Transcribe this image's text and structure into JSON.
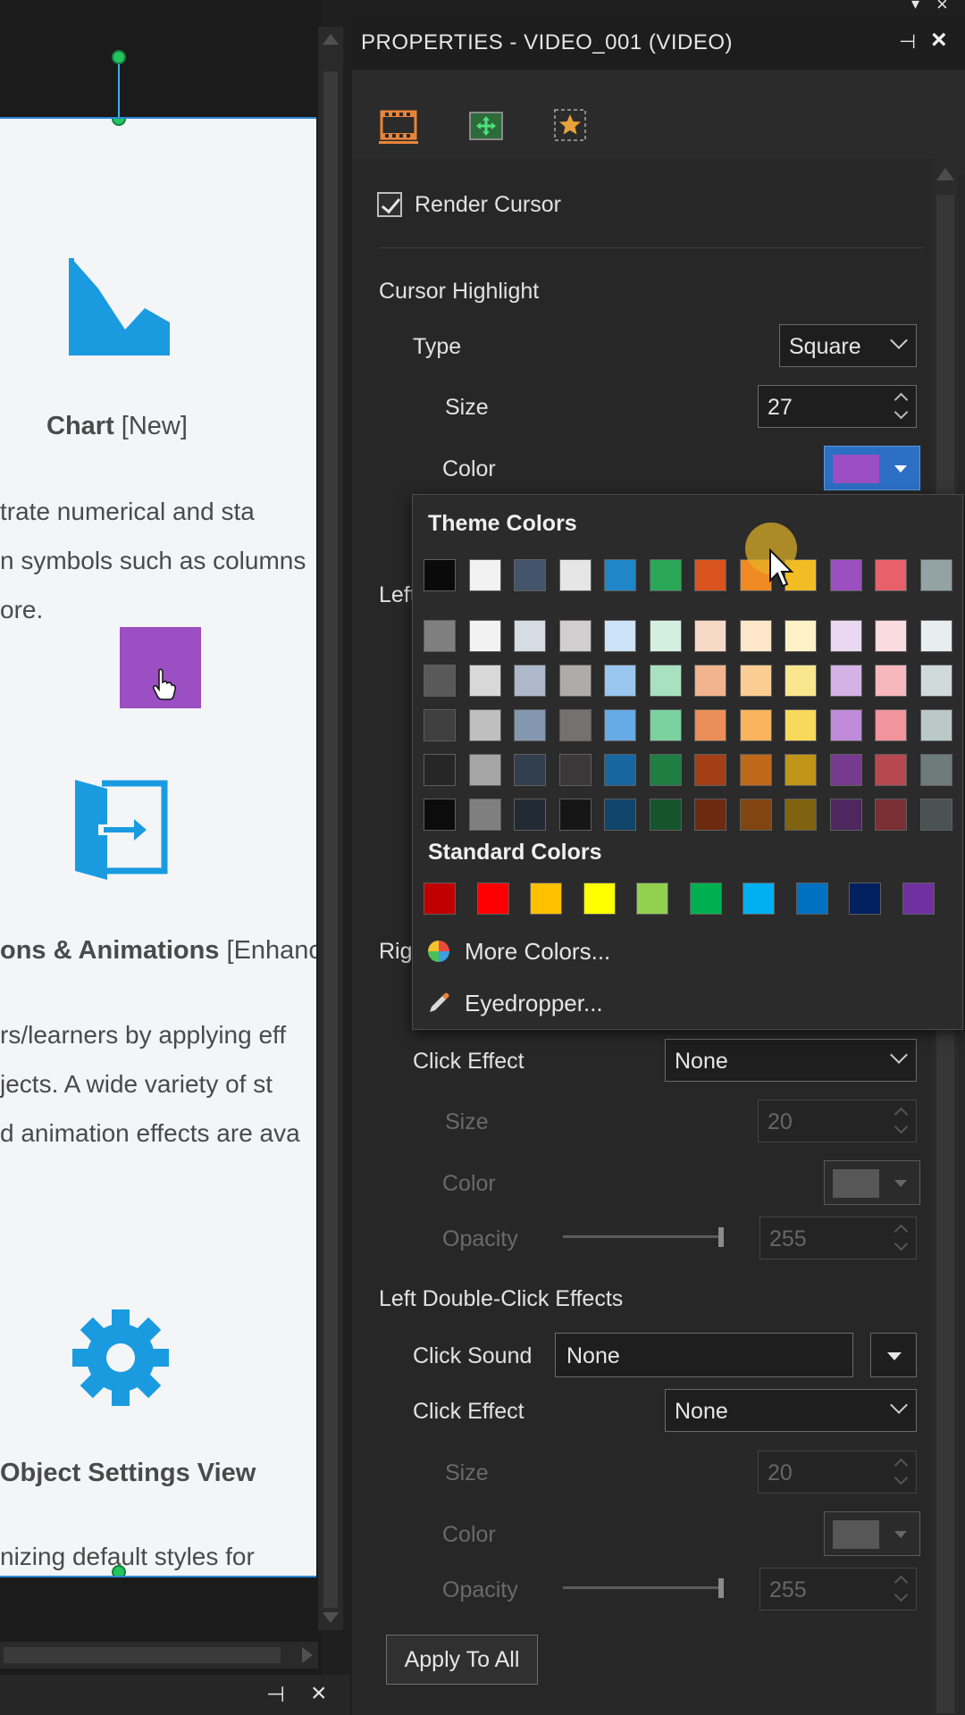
{
  "canvas": {
    "feature1": {
      "title": "Chart",
      "badge": "[New]",
      "line1": "trate  numerical  and  sta",
      "line2": "n symbols such as columns",
      "line3": "ore."
    },
    "feature2": {
      "title": "ons & Animations",
      "badge": "[Enhanc",
      "line1": "rs/learners by applying eff",
      "line2": "jects. A wide variety of st",
      "line3": "d animation effects are ava"
    },
    "feature3": {
      "title": "Object Settings View",
      "line1": "nizing  default  styles  for"
    },
    "square_color": "#9b4fc2",
    "icon_color": "#1a9be0"
  },
  "panel": {
    "title": "PROPERTIES - VIDEO_001 (VIDEO)",
    "tabs": [
      "film-icon",
      "move-icon",
      "star-icon"
    ],
    "render_cursor_label": "Render Cursor",
    "render_cursor_checked": true,
    "cursor_highlight": {
      "section_label": "Cursor Highlight",
      "type_label": "Type",
      "type_value": "Square",
      "size_label": "Size",
      "size_value": "27",
      "color_label": "Color",
      "color_value": "#9b4fc2"
    },
    "left_click_label": "Left",
    "right_click_label": "Rig",
    "right_click": {
      "click_effect_label": "Click Effect",
      "click_effect_value": "None",
      "size_label": "Size",
      "size_value": "20",
      "color_label": "Color",
      "opacity_label": "Opacity",
      "opacity_value": "255"
    },
    "left_double_click": {
      "section_label": "Left Double-Click Effects",
      "click_sound_label": "Click Sound",
      "click_sound_value": "None",
      "click_effect_label": "Click Effect",
      "click_effect_value": "None",
      "size_label": "Size",
      "size_value": "20",
      "color_label": "Color",
      "opacity_label": "Opacity",
      "opacity_value": "255"
    },
    "apply_label": "Apply To All"
  },
  "color_popup": {
    "theme_heading": "Theme Colors",
    "standard_heading": "Standard Colors",
    "theme_colors": [
      [
        "#0a0a0a",
        "#f2f2f2",
        "#44546a",
        "#e7e6e6",
        "#1e86c9",
        "#2aa858",
        "#d9531e",
        "#f08a24",
        "#f2bd24",
        "#9c4fbf",
        "#e8606a",
        "#93a3a3"
      ],
      [
        "#7f7f7f",
        "#f2f2f2",
        "#d6dce4",
        "#d0cece",
        "#cce2f7",
        "#d3f0df",
        "#f8d9c7",
        "#fde6c9",
        "#fdf2c7",
        "#ead8f2",
        "#fadbde",
        "#e8eded"
      ],
      [
        "#595959",
        "#d8d8d8",
        "#adb9ca",
        "#aeabab",
        "#99c6ee",
        "#a8e1bf",
        "#f2b48f",
        "#fbcd93",
        "#fbe690",
        "#d5b2e5",
        "#f6b8bd",
        "#d1dada"
      ],
      [
        "#3f3f3f",
        "#bfbfbf",
        "#8497b0",
        "#757171",
        "#66aae6",
        "#7cd29f",
        "#eb8e57",
        "#f9b45d",
        "#f9d959",
        "#c08bd8",
        "#f1949c",
        "#bac8c8"
      ],
      [
        "#262626",
        "#a5a5a5",
        "#323f4f",
        "#3a3838",
        "#1766a0",
        "#1f7e42",
        "#a33f16",
        "#c0681a",
        "#c09418",
        "#763a8f",
        "#b8484f",
        "#6e7b7b"
      ],
      [
        "#0c0c0c",
        "#7f7f7f",
        "#222a35",
        "#171616",
        "#0f446b",
        "#15542c",
        "#6c2a0f",
        "#804511",
        "#806310",
        "#4e275f",
        "#7a3035",
        "#4a5252"
      ]
    ],
    "standard_colors": [
      "#c00000",
      "#ff0000",
      "#ffc000",
      "#ffff00",
      "#92d050",
      "#00b050",
      "#00b0f0",
      "#0070c0",
      "#002060",
      "#7030a0"
    ],
    "more_colors_label": "More Colors...",
    "eyedropper_label": "Eyedropper..."
  }
}
